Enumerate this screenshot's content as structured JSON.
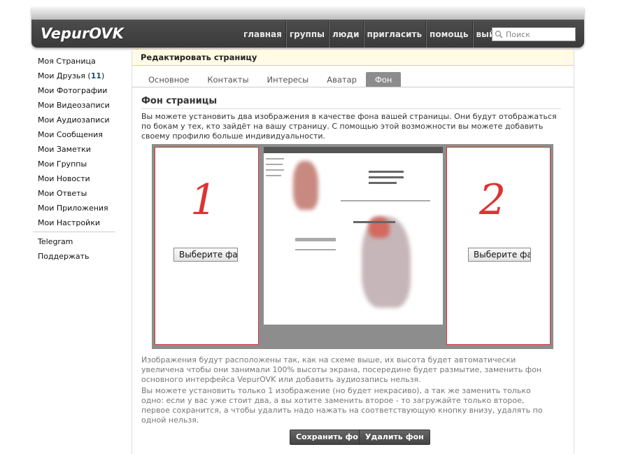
{
  "logo": {
    "text": "VepurOVK"
  },
  "nav": [
    "главная",
    "группы",
    "люди",
    "пригласить",
    "помощь",
    "выйти"
  ],
  "search": {
    "placeholder": "Поиск"
  },
  "sidebar": {
    "items": [
      {
        "label": "Моя Страница"
      },
      {
        "label": "Мои Друзья",
        "count": "11"
      },
      {
        "label": "Мои Фотографии"
      },
      {
        "label": "Мои Видеозаписи"
      },
      {
        "label": "Мои Аудиозаписи"
      },
      {
        "label": "Мои Сообщения"
      },
      {
        "label": "Мои Заметки"
      },
      {
        "label": "Мои Группы"
      },
      {
        "label": "Мои Новости"
      },
      {
        "label": "Мои Ответы"
      },
      {
        "label": "Мои Приложения"
      },
      {
        "label": "Мои Настройки"
      }
    ],
    "extra": [
      {
        "label": "Telegram"
      },
      {
        "label": "Поддержать"
      }
    ]
  },
  "page": {
    "title": "Редактировать страницу",
    "tabs": [
      "Основное",
      "Контакты",
      "Интересы",
      "Аватар",
      "Фон"
    ],
    "active_tab": "Фон",
    "section_title": "Фон страницы",
    "description": "Вы можете установить два изображения в качестве фона вашей страницы. Они будут отображаться по бокам у тех, кто зайдёт на вашу страницу. С помощью этой возможности вы можете добавить своему профилю больше индивидуальности.",
    "panel_left_number": "1",
    "panel_right_number": "2",
    "file_button": "Выберите фа",
    "note1": "Изображения будут расположены так, как на схеме выше, их высота будет автоматически увеличена чтобы они занимали 100% высоты экрана, посередине будет размытие, заменить фон основного интерфейса VepurOVK или добавить аудиозапись нельзя.",
    "note2": "Вы можете установить только 1 изображение (но будет некрасиво), а так же заменить только одно: если у вас уже стоит два, а вы хотите заменить второе - то загружайте только второе, первое сохранится, а чтобы удалить надо нажать на соответствующую кнопку внизу, удалять по одной нельзя.",
    "save_button": "Сохранить фон",
    "delete_button": "Удалить фон"
  },
  "colors": {
    "accent": "#d33333",
    "header": "#4a4a4a",
    "title_bg": "#fffbe6"
  }
}
